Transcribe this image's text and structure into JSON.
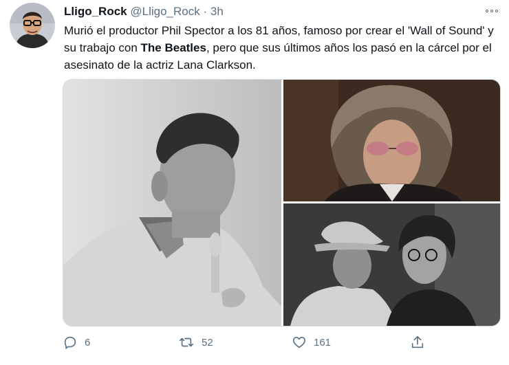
{
  "tweet": {
    "author_name": "Lligo_Rock",
    "handle": "@Lligo_Rock",
    "separator": "·",
    "time": "3h",
    "text_part1": "Murió el productor Phil Spector a los 81 años, famoso por crear el 'Wall of Sound' y su trabajo con ",
    "text_bold": "The Beatles",
    "text_part2": ", pero que sus últimos años los pasó en la cárcel por el asesinato de la actriz Lana Clarkson."
  },
  "media": {
    "photos": [
      "studio-portrait-photo",
      "courtroom-portrait-photo",
      "two-men-in-hats-photo"
    ]
  },
  "actions": {
    "replies": "6",
    "retweets": "52",
    "likes": "161"
  },
  "icons": [
    "more-options-icon",
    "reply-icon",
    "retweet-icon",
    "like-icon",
    "share-icon"
  ],
  "colors": {
    "text": "#0f1419",
    "secondary": "#5b7083",
    "border": "#cfd9de"
  }
}
